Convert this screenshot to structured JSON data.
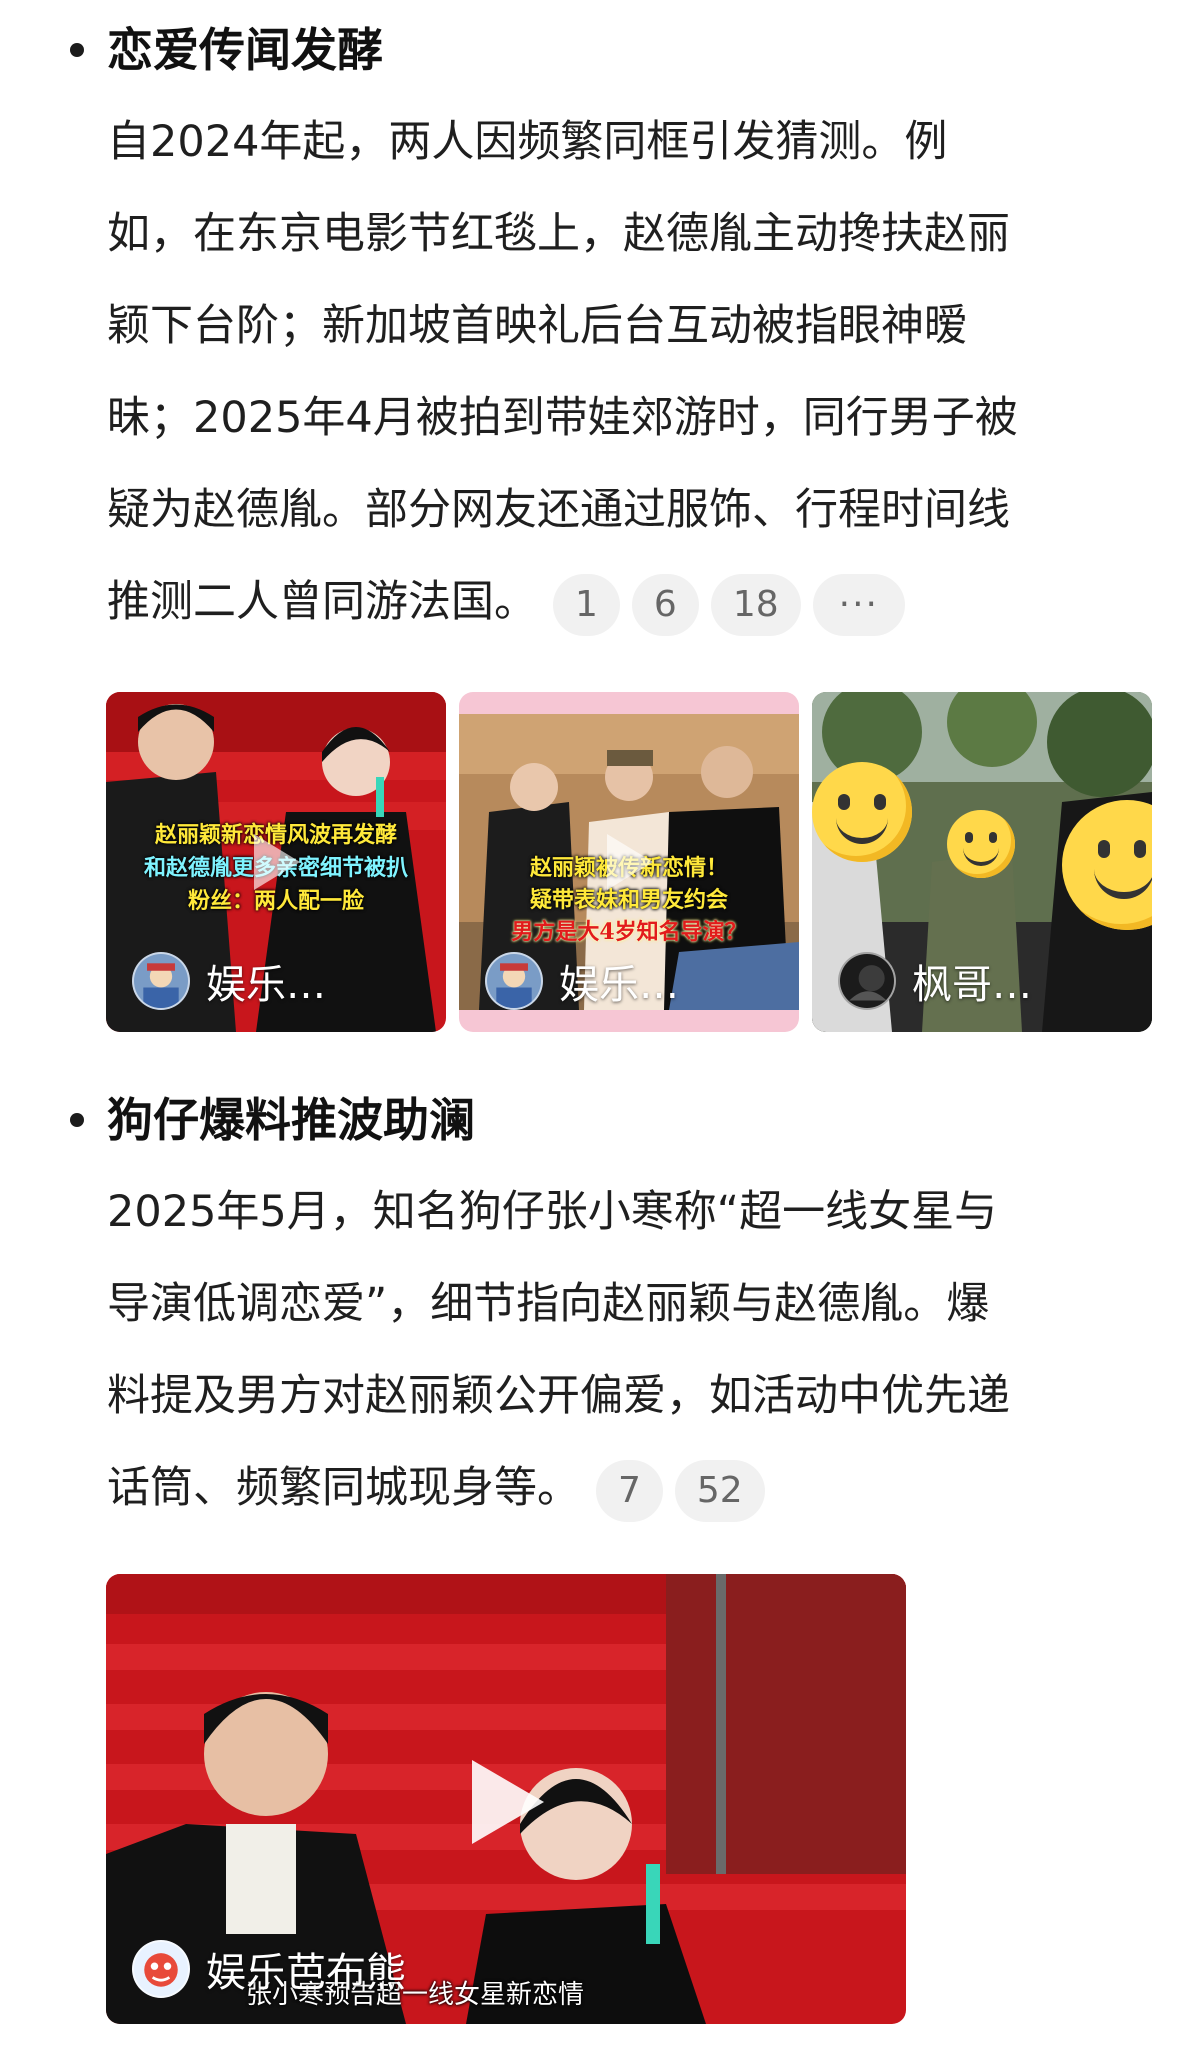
{
  "sections": [
    {
      "heading": "恋爱传闻发酵",
      "lines": [
        "自2024年起，两人因频繁同框引发猜测。例",
        "如，在东京电影节红毯上，赵德胤主动搀扶赵丽",
        "颖下台阶；新加坡首映礼后台互动被指眼神暧",
        "昧；2025年4月被拍到带娃郊游时，同行男子被",
        "疑为赵德胤。部分网友还通过服饰、行程时间线",
        "推测二人曾同游法国。"
      ],
      "citations": [
        "1",
        "6",
        "18",
        "···"
      ],
      "videos": [
        {
          "overlay_lines": [
            "赵丽颖新恋情风波再发酵",
            "和赵德胤更多亲密细节被扒",
            "粉丝：两人配一脸"
          ],
          "author": "娱乐…"
        },
        {
          "overlay_lines": [
            "赵丽颖被传新恋情！",
            "疑带表妹和男友约会",
            "男方是大4岁知名导演？"
          ],
          "author": "娱乐…"
        },
        {
          "overlay_lines": [],
          "author": "枫哥…"
        }
      ]
    },
    {
      "heading": "狗仔爆料推波助澜",
      "lines": [
        "2025年5月，知名狗仔张小寒称“超一线女星与",
        "导演低调恋爱”，细节指向赵丽颖与赵德胤。爆",
        "料提及男方对赵丽颖公开偏爱，如活动中优先递",
        "话筒、频繁同城现身等。"
      ],
      "citations": [
        "7",
        "52"
      ],
      "video": {
        "author": "娱乐芭布熊",
        "caption": "张小寒预告超一线女星新恋情"
      }
    }
  ],
  "colors": {
    "text": "#1f1f1f",
    "citation_bg": "#f1f1f1",
    "citation_text": "#666666",
    "overlay_yellow": "#ffe93a",
    "overlay_cyan": "#7ff3ff",
    "overlay_red": "#e21b1b",
    "carpet_red": "#c8161c"
  }
}
